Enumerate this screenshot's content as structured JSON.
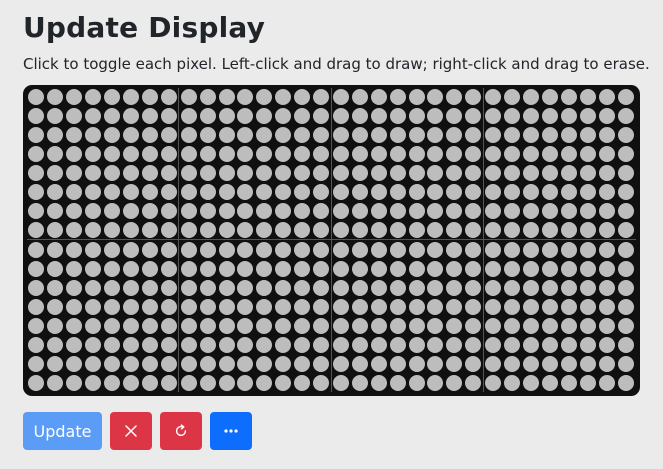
{
  "page": {
    "title": "Update Display",
    "instructions": "Click to toggle each pixel. Left-click and drag to draw; right-click and drag to erase."
  },
  "display": {
    "panel_columns": 4,
    "panel_rows": 2,
    "pixels_per_panel_side": 8,
    "off_color": "#bdbdbd",
    "on_color": "#ffd23c",
    "background_color": "#101010",
    "lit_pixels": []
  },
  "toolbar": {
    "update_label": "Update",
    "clear_icon": "x-icon",
    "reset_icon": "refresh-icon",
    "more_icon": "ellipsis-icon",
    "update_color": "#5b9cf6",
    "danger_color": "#dc3545",
    "primary_color": "#0d6efd"
  }
}
